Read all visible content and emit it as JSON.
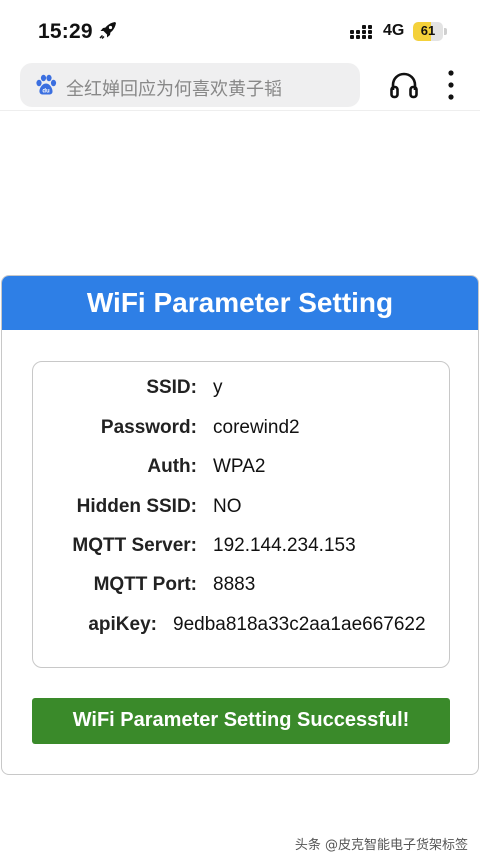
{
  "status_bar": {
    "time": "15:29",
    "network": "4G",
    "battery_level": "61",
    "battery_fraction": 0.61,
    "battery_color": "#f4d13a"
  },
  "browser": {
    "search_text": "全红婵回应为何喜欢黄子韬"
  },
  "card": {
    "title": "WiFi Parameter Setting",
    "header_color": "#2e7fe6",
    "fields": [
      {
        "label": "SSID:",
        "value": "y"
      },
      {
        "label": "Password:",
        "value": "corewind2"
      },
      {
        "label": "Auth:",
        "value": "WPA2"
      },
      {
        "label": "Hidden SSID:",
        "value": "NO"
      },
      {
        "label": "MQTT Server:",
        "value": "192.144.234.153"
      },
      {
        "label": "MQTT Port:",
        "value": "8883"
      },
      {
        "label": "apiKey:",
        "value": "9edba818a33c2aa1ae667622"
      }
    ],
    "success_message": "WiFi Parameter Setting Successful!",
    "success_color": "#3a8a2a"
  },
  "watermark": "头条 @皮克智能电子货架标签"
}
